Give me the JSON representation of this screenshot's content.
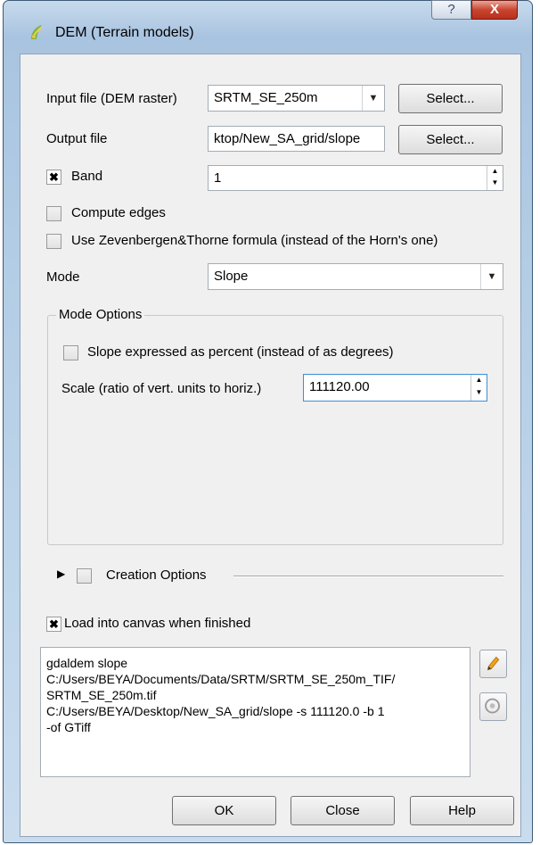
{
  "window": {
    "title": "DEM (Terrain models)",
    "help_glyph": "?",
    "close_glyph": "X",
    "app_icon": "qgis-icon"
  },
  "form": {
    "input_label": "Input file (DEM raster)",
    "input_value": "SRTM_SE_250m",
    "output_label": "Output file",
    "output_value": "ktop/New_SA_grid/slope",
    "select_label": "Select...",
    "band_label": "Band",
    "band_checked": true,
    "band_value": "1",
    "compute_edges_label": "Compute edges",
    "compute_edges_checked": false,
    "zevenbergen_label": "Use Zevenbergen&Thorne formula (instead of the Horn's one)",
    "zevenbergen_checked": false,
    "mode_label": "Mode",
    "mode_value": "Slope"
  },
  "mode_options": {
    "title": "Mode Options",
    "percent_label": "Slope expressed as percent (instead of as degrees)",
    "percent_checked": false,
    "scale_label": "Scale (ratio of vert. units to horiz.)",
    "scale_value": "111120.00"
  },
  "creation_options": {
    "label": "Creation Options",
    "checked": false
  },
  "load_canvas": {
    "label": "Load into canvas when finished",
    "checked": true
  },
  "command": {
    "text": "gdaldem slope\nC:/Users/BEYA/Documents/Data/SRTM/SRTM_SE_250m_TIF/\nSRTM_SE_250m.tif\nC:/Users/BEYA/Desktop/New_SA_grid/slope -s 111120.0 -b 1\n-of GTiff"
  },
  "buttons": {
    "ok": "OK",
    "close": "Close",
    "help": "Help"
  },
  "icons": {
    "check_mark": "✖",
    "edit": "edit-pencil-icon",
    "reset": "reset-icon"
  },
  "colors": {
    "frame": "#b3cde6",
    "close_button": "#c9452f"
  }
}
